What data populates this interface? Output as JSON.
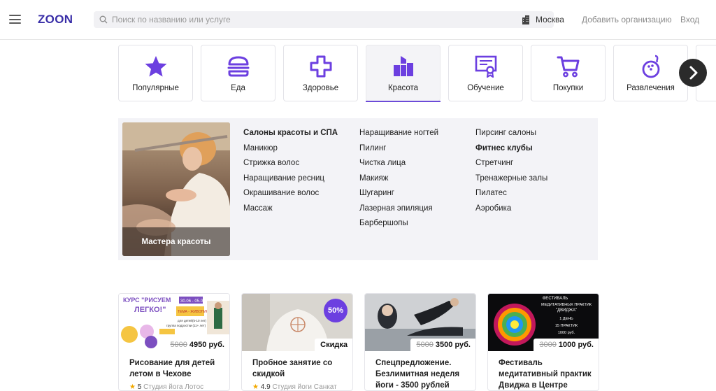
{
  "header": {
    "logo": "ZOON",
    "search_placeholder": "Поиск по названию или услуге",
    "city": "Москва",
    "add_org": "Добавить организацию",
    "login": "Вход"
  },
  "categories": [
    {
      "label": "Популярные",
      "icon": "star-icon"
    },
    {
      "label": "Еда",
      "icon": "burger-icon"
    },
    {
      "label": "Здоровье",
      "icon": "medical-cross-icon"
    },
    {
      "label": "Красота",
      "icon": "beauty-icon",
      "active": true
    },
    {
      "label": "Обучение",
      "icon": "certificate-icon"
    },
    {
      "label": "Покупки",
      "icon": "shopping-cart-icon"
    },
    {
      "label": "Развлечения",
      "icon": "bowling-icon"
    }
  ],
  "dropdown": {
    "promo_title": "Мастера красоты",
    "col1": [
      "Салоны красоты и СПА",
      "Маникюр",
      "Стрижка волос",
      "Наращивание ресниц",
      "Окрашивание волос",
      "Массаж"
    ],
    "col2": [
      "Наращивание ногтей",
      "Пилинг",
      "Чистка лица",
      "Макияж",
      "Шугаринг",
      "Лазерная эпиляция",
      "Барбершопы"
    ],
    "col3": [
      "Пирсинг салоны",
      "Фитнес клубы",
      "Стретчинг",
      "Тренажерные залы",
      "Пилатес",
      "Аэробика"
    ]
  },
  "offers": [
    {
      "title": "Рисование для детей летом в Чехове",
      "old_price": "5000",
      "new_price": "4950 руб.",
      "rating": "5",
      "place": "Студия йога Лотос",
      "image_text": [
        "КУРС \"РИСУЕМ",
        "ЛЕГКО!\"",
        "30.06 - 05.07",
        "ТЕМА - ЖИВОПИСЬ",
        "для детей(5-10 лет)",
        "группа подростки (11+ лет)"
      ]
    },
    {
      "title": "Пробное занятие со скидкой",
      "badge": "50%",
      "tag": "Скидка",
      "rating": "4.9",
      "place": "Студия йоги Санкат"
    },
    {
      "title": "Спецпредложение. Безлимитная неделя йоги - 3500 рублей",
      "old_price": "5000",
      "new_price": "3500 руб."
    },
    {
      "title": "Фестиваль медитативный практик Двиджа в Центре",
      "old_price": "3000",
      "new_price": "1000 руб.",
      "image_text": [
        "ФЕСТИВАЛЬ",
        "МЕДИТАТИВНЫХ ПРАКТИК",
        "\"ДВИДЖА\"",
        "1 ДЕНЬ",
        "15 ПРАКТИК",
        "1000 руб."
      ]
    }
  ],
  "colors": {
    "accent": "#6c4bd8",
    "logo": "#3a2fa8",
    "panel_bg": "#f3f3f7"
  }
}
